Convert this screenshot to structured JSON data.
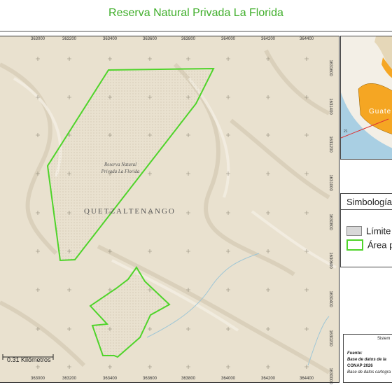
{
  "title": "Reserva Natural Privada La Florida",
  "map": {
    "x_ticks": [
      "363000",
      "363200",
      "363400",
      "363600",
      "363800",
      "364000",
      "364200",
      "364400"
    ],
    "y_ticks": [
      "1631600",
      "1631400",
      "1631200",
      "1631000",
      "1630800",
      "1630600",
      "1630400",
      "1630200",
      "1630000"
    ],
    "reserve_label": "Reserva Natural Privada La Florida",
    "place_label": "QUETZALTENANGO",
    "scale_label": "0.31 Kilómetros",
    "colors": {
      "terrain": "#e9e1cf",
      "boundary": "#4fd42a",
      "reserve_fill": "#ddd5c0"
    }
  },
  "inset": {
    "label": "Guate",
    "number_label": "21",
    "colors": {
      "sea": "#a9cfe3",
      "land": "#f3efe6",
      "highlight": "#f5a623",
      "arrow": "#d33"
    }
  },
  "legend": {
    "title": "Simbología",
    "items": [
      {
        "label": "Límite",
        "color": "#d8d8d8",
        "border": "#888888"
      },
      {
        "label": "Área pr",
        "color": "#ffffff",
        "border": "#4fd42a"
      }
    ]
  },
  "source": {
    "system": "Sistem",
    "fuente": "Fuente:",
    "line1": "Base de datos de la",
    "line2": "CONAP 2026",
    "line3": "Base de datos cartogra"
  }
}
